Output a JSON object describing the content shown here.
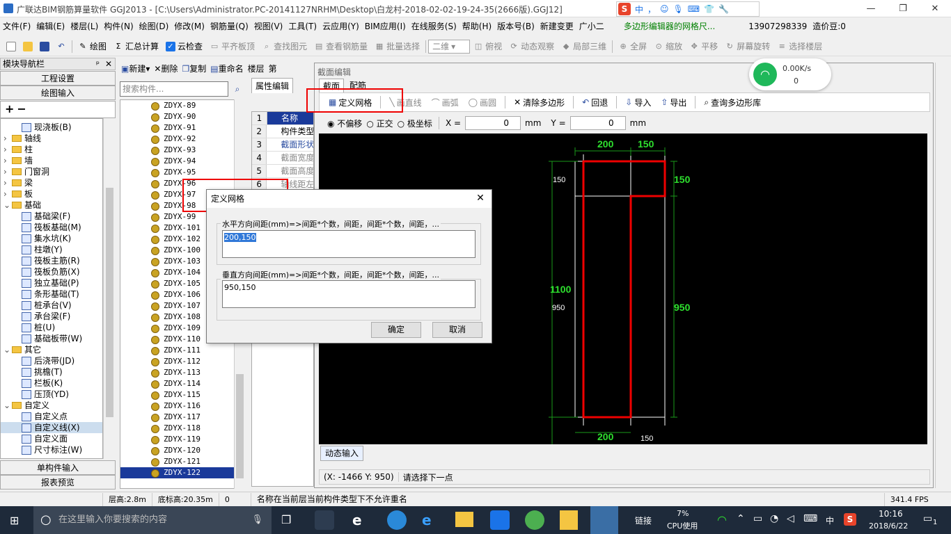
{
  "window": {
    "title": "广联达BIM钢筋算量软件 GGJ2013 - [C:\\Users\\Administrator.PC-20141127NRHM\\Desktop\\白龙村-2018-02-02-19-24-35(2666版).GGJ12]",
    "min": "—",
    "restore": "❐",
    "close": "✕"
  },
  "ime": {
    "items": [
      "中",
      "，",
      "☺",
      "🎙",
      "⌨",
      "👕",
      "🔧"
    ]
  },
  "menu": [
    "文件(F)",
    "编辑(E)",
    "楼层(L)",
    "构件(N)",
    "绘图(D)",
    "修改(M)",
    "钢筋量(Q)",
    "视图(V)",
    "工具(T)",
    "云应用(Y)",
    "BIM应用(I)",
    "在线服务(S)",
    "帮助(H)",
    "版本号(B)",
    "新建变更",
    "广小二",
    "多边形编辑器的网格尺...",
    "13907298339",
    "造价豆:0"
  ],
  "toolbar": [
    "绘图",
    "汇总计算",
    "云检查",
    "平齐板顶",
    "查找图元",
    "查看钢筋量",
    "批量选择",
    "二维",
    "俯视",
    "动态观察",
    "局部三维",
    "全屏",
    "缩放",
    "平移",
    "屏幕旋转",
    "选择楼层"
  ],
  "nav": {
    "title": "模块导航栏",
    "pin": "ᵖ",
    "close": "✕",
    "project_settings": "工程设置",
    "drawing_input": "绘图输入",
    "single_input": "单构件输入",
    "report_preview": "报表预览",
    "plus": "+",
    "minus": "−"
  },
  "tree": [
    {
      "label": "现浇板(B)",
      "indent": 3,
      "type": "leaf"
    },
    {
      "label": "轴线",
      "indent": 1,
      "type": "folder"
    },
    {
      "label": "柱",
      "indent": 1,
      "type": "folder"
    },
    {
      "label": "墙",
      "indent": 1,
      "type": "folder"
    },
    {
      "label": "门窗洞",
      "indent": 1,
      "type": "folder"
    },
    {
      "label": "梁",
      "indent": 1,
      "type": "folder"
    },
    {
      "label": "板",
      "indent": 1,
      "type": "folder"
    },
    {
      "label": "基础",
      "indent": 1,
      "type": "folder-open"
    },
    {
      "label": "基础梁(F)",
      "indent": 3,
      "type": "leaf"
    },
    {
      "label": "筏板基础(M)",
      "indent": 3,
      "type": "leaf"
    },
    {
      "label": "集水坑(K)",
      "indent": 3,
      "type": "leaf"
    },
    {
      "label": "柱墩(Y)",
      "indent": 3,
      "type": "leaf"
    },
    {
      "label": "筏板主筋(R)",
      "indent": 3,
      "type": "leaf"
    },
    {
      "label": "筏板负筋(X)",
      "indent": 3,
      "type": "leaf"
    },
    {
      "label": "独立基础(P)",
      "indent": 3,
      "type": "leaf"
    },
    {
      "label": "条形基础(T)",
      "indent": 3,
      "type": "leaf"
    },
    {
      "label": "桩承台(V)",
      "indent": 3,
      "type": "leaf"
    },
    {
      "label": "承台梁(F)",
      "indent": 3,
      "type": "leaf"
    },
    {
      "label": "桩(U)",
      "indent": 3,
      "type": "leaf"
    },
    {
      "label": "基础板带(W)",
      "indent": 3,
      "type": "leaf"
    },
    {
      "label": "其它",
      "indent": 1,
      "type": "folder-open"
    },
    {
      "label": "后浇带(JD)",
      "indent": 3,
      "type": "leaf"
    },
    {
      "label": "挑檐(T)",
      "indent": 3,
      "type": "leaf"
    },
    {
      "label": "栏板(K)",
      "indent": 3,
      "type": "leaf"
    },
    {
      "label": "压顶(YD)",
      "indent": 3,
      "type": "leaf"
    },
    {
      "label": "自定义",
      "indent": 1,
      "type": "folder-open"
    },
    {
      "label": "自定义点",
      "indent": 3,
      "type": "leaf"
    },
    {
      "label": "自定义线(X)",
      "indent": 3,
      "type": "leaf"
    },
    {
      "label": "自定义面",
      "indent": 3,
      "type": "leaf"
    },
    {
      "label": "尺寸标注(W)",
      "indent": 3,
      "type": "leaf"
    }
  ],
  "comp_toolbar": [
    "新建",
    "删除",
    "复制",
    "重命名",
    "楼层",
    "第"
  ],
  "search": {
    "placeholder": "搜索构件..."
  },
  "components": [
    "ZDYX-89",
    "ZDYX-90",
    "ZDYX-91",
    "ZDYX-92",
    "ZDYX-93",
    "ZDYX-94",
    "ZDYX-95",
    "ZDYX-96",
    "ZDYX-97",
    "ZDYX-98",
    "ZDYX-99",
    "ZDYX-101",
    "ZDYX-102",
    "ZDYX-100",
    "ZDYX-103",
    "ZDYX-104",
    "ZDYX-105",
    "ZDYX-106",
    "ZDYX-107",
    "ZDYX-108",
    "ZDYX-109",
    "ZDYX-110",
    "ZDYX-111",
    "ZDYX-112",
    "ZDYX-113",
    "ZDYX-114",
    "ZDYX-115",
    "ZDYX-116",
    "ZDYX-117",
    "ZDYX-118",
    "ZDYX-119",
    "ZDYX-120",
    "ZDYX-121",
    "ZDYX-122"
  ],
  "props": {
    "tab": "属性编辑",
    "rows": [
      {
        "n": "1",
        "v": "名称"
      },
      {
        "n": "2",
        "v": "构件类型"
      },
      {
        "n": "3",
        "v": "截面形状"
      },
      {
        "n": "4",
        "v": "截面宽度"
      },
      {
        "n": "5",
        "v": "截面高度"
      },
      {
        "n": "6",
        "v": "轴线距左"
      }
    ]
  },
  "editor": {
    "title": "截面编辑",
    "tabs": [
      "截面",
      "配筋"
    ],
    "tools": [
      "定义网格",
      "画直线",
      "画弧",
      "画圆",
      "清除多边形",
      "回退",
      "导入",
      "导出",
      "查询多边形库"
    ],
    "offset_opts": [
      "不偏移",
      "正交",
      "极坐标"
    ],
    "x_label": "X =",
    "x_value": "0",
    "y_label": "Y =",
    "y_value": "0",
    "unit": "mm",
    "dynamic_input": "动态输入",
    "coords": "(X: -1466 Y: 950)",
    "prompt": "请选择下一点"
  },
  "dims": {
    "top1": "200",
    "top2": "150",
    "right_top": "150",
    "right_main": "950",
    "left_top": "150",
    "left_main": "950",
    "left_total": "1100",
    "bottom1": "200",
    "bottom2": "150",
    "bottom_dup": "200"
  },
  "dialog": {
    "title": "定义网格",
    "h_label": "水平方向间距(mm)=>间距*个数，间距，间距*个数，间距，...",
    "h_value": "200,150",
    "v_label": "垂直方向间距(mm)=>间距*个数，间距，间距*个数，间距，...",
    "v_value": "950,150",
    "ok": "确定",
    "cancel": "取消",
    "close": "✕"
  },
  "wifi": {
    "speed": "0.00K/s",
    "count": "0"
  },
  "status": {
    "floor_height": "层高:2.8m",
    "bottom_height": "底标高:20.35m",
    "zero": "0",
    "message": "名称在当前层当前构件类型下不允许重名",
    "fps": "341.4 FPS"
  },
  "taskbar": {
    "search": "在这里输入你要搜索的内容",
    "link": "链接",
    "cpu_pct": "7%",
    "cpu_label": "CPU使用",
    "lang": "中",
    "time": "10:16",
    "date": "2018/6/22",
    "notif": "1"
  }
}
